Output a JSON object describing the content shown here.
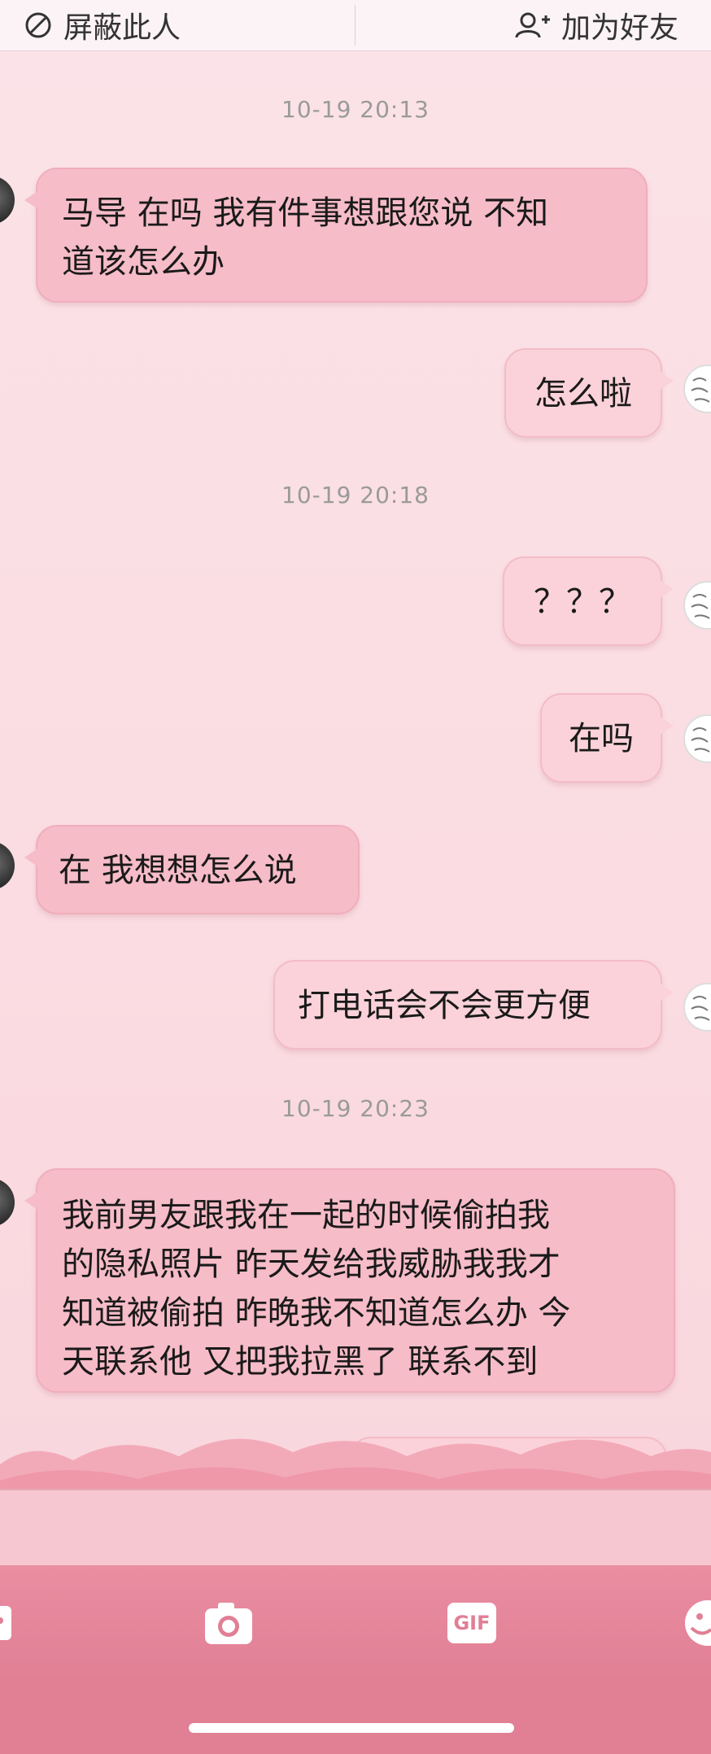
{
  "top_bar": {
    "block_label": "屏蔽此人",
    "add_friend_label": "加为好友"
  },
  "messages": [
    {
      "type": "timestamp",
      "text": "10-19 20:13"
    },
    {
      "type": "received",
      "text": "马导 在吗 我有件事想跟您说 不知\n道该怎么办"
    },
    {
      "type": "sent",
      "text": "怎么啦"
    },
    {
      "type": "timestamp",
      "text": "10-19 20:18"
    },
    {
      "type": "sent",
      "text": "？？？"
    },
    {
      "type": "sent",
      "text": "在吗"
    },
    {
      "type": "received",
      "text": "在 我想想怎么说"
    },
    {
      "type": "sent",
      "text": "打电话会不会更方便"
    },
    {
      "type": "timestamp",
      "text": "10-19 20:23"
    },
    {
      "type": "received",
      "text": "我前男友跟我在一起的时候偷拍我\n的隐私照片 昨天发给我威胁我我才\n知道被偷拍 昨晚我不知道怎么办 今\n天联系他 又把我拉黑了 联系不到"
    }
  ],
  "toolbar": {
    "icons": [
      "emoji-panel-icon",
      "camera-icon",
      "gif-icon",
      "smiley-icon"
    ],
    "gif_label": "GIF"
  },
  "colors": {
    "background": "#fadbe1",
    "bubble_received": "#f6bcc8",
    "bubble_sent": "#fbd2da",
    "toolbar": "#e17f95"
  }
}
